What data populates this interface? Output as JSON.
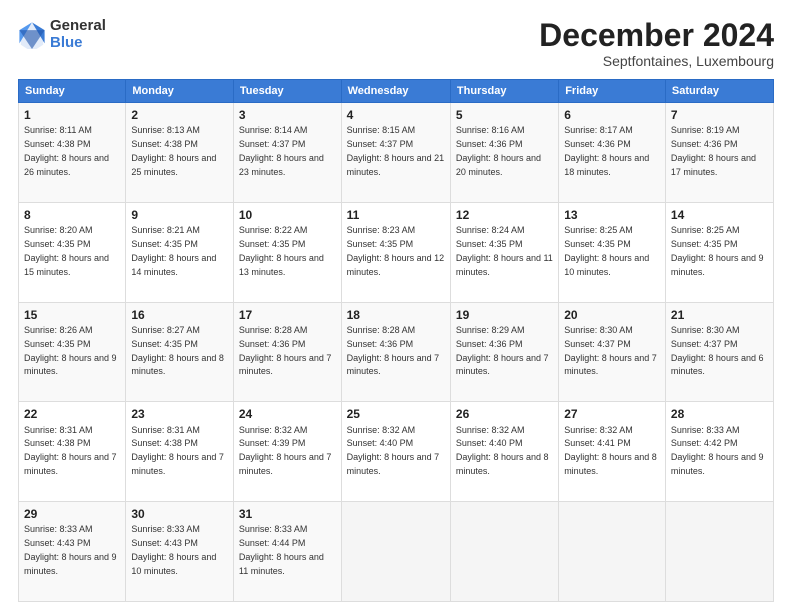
{
  "header": {
    "logo_general": "General",
    "logo_blue": "Blue",
    "title": "December 2024",
    "location": "Septfontaines, Luxembourg"
  },
  "days_of_week": [
    "Sunday",
    "Monday",
    "Tuesday",
    "Wednesday",
    "Thursday",
    "Friday",
    "Saturday"
  ],
  "weeks": [
    [
      {
        "day": "1",
        "sunrise": "8:11 AM",
        "sunset": "4:38 PM",
        "daylight": "8 hours and 26 minutes."
      },
      {
        "day": "2",
        "sunrise": "8:13 AM",
        "sunset": "4:38 PM",
        "daylight": "8 hours and 25 minutes."
      },
      {
        "day": "3",
        "sunrise": "8:14 AM",
        "sunset": "4:37 PM",
        "daylight": "8 hours and 23 minutes."
      },
      {
        "day": "4",
        "sunrise": "8:15 AM",
        "sunset": "4:37 PM",
        "daylight": "8 hours and 21 minutes."
      },
      {
        "day": "5",
        "sunrise": "8:16 AM",
        "sunset": "4:36 PM",
        "daylight": "8 hours and 20 minutes."
      },
      {
        "day": "6",
        "sunrise": "8:17 AM",
        "sunset": "4:36 PM",
        "daylight": "8 hours and 18 minutes."
      },
      {
        "day": "7",
        "sunrise": "8:19 AM",
        "sunset": "4:36 PM",
        "daylight": "8 hours and 17 minutes."
      }
    ],
    [
      {
        "day": "8",
        "sunrise": "8:20 AM",
        "sunset": "4:35 PM",
        "daylight": "8 hours and 15 minutes."
      },
      {
        "day": "9",
        "sunrise": "8:21 AM",
        "sunset": "4:35 PM",
        "daylight": "8 hours and 14 minutes."
      },
      {
        "day": "10",
        "sunrise": "8:22 AM",
        "sunset": "4:35 PM",
        "daylight": "8 hours and 13 minutes."
      },
      {
        "day": "11",
        "sunrise": "8:23 AM",
        "sunset": "4:35 PM",
        "daylight": "8 hours and 12 minutes."
      },
      {
        "day": "12",
        "sunrise": "8:24 AM",
        "sunset": "4:35 PM",
        "daylight": "8 hours and 11 minutes."
      },
      {
        "day": "13",
        "sunrise": "8:25 AM",
        "sunset": "4:35 PM",
        "daylight": "8 hours and 10 minutes."
      },
      {
        "day": "14",
        "sunrise": "8:25 AM",
        "sunset": "4:35 PM",
        "daylight": "8 hours and 9 minutes."
      }
    ],
    [
      {
        "day": "15",
        "sunrise": "8:26 AM",
        "sunset": "4:35 PM",
        "daylight": "8 hours and 9 minutes."
      },
      {
        "day": "16",
        "sunrise": "8:27 AM",
        "sunset": "4:35 PM",
        "daylight": "8 hours and 8 minutes."
      },
      {
        "day": "17",
        "sunrise": "8:28 AM",
        "sunset": "4:36 PM",
        "daylight": "8 hours and 7 minutes."
      },
      {
        "day": "18",
        "sunrise": "8:28 AM",
        "sunset": "4:36 PM",
        "daylight": "8 hours and 7 minutes."
      },
      {
        "day": "19",
        "sunrise": "8:29 AM",
        "sunset": "4:36 PM",
        "daylight": "8 hours and 7 minutes."
      },
      {
        "day": "20",
        "sunrise": "8:30 AM",
        "sunset": "4:37 PM",
        "daylight": "8 hours and 7 minutes."
      },
      {
        "day": "21",
        "sunrise": "8:30 AM",
        "sunset": "4:37 PM",
        "daylight": "8 hours and 6 minutes."
      }
    ],
    [
      {
        "day": "22",
        "sunrise": "8:31 AM",
        "sunset": "4:38 PM",
        "daylight": "8 hours and 7 minutes."
      },
      {
        "day": "23",
        "sunrise": "8:31 AM",
        "sunset": "4:38 PM",
        "daylight": "8 hours and 7 minutes."
      },
      {
        "day": "24",
        "sunrise": "8:32 AM",
        "sunset": "4:39 PM",
        "daylight": "8 hours and 7 minutes."
      },
      {
        "day": "25",
        "sunrise": "8:32 AM",
        "sunset": "4:40 PM",
        "daylight": "8 hours and 7 minutes."
      },
      {
        "day": "26",
        "sunrise": "8:32 AM",
        "sunset": "4:40 PM",
        "daylight": "8 hours and 8 minutes."
      },
      {
        "day": "27",
        "sunrise": "8:32 AM",
        "sunset": "4:41 PM",
        "daylight": "8 hours and 8 minutes."
      },
      {
        "day": "28",
        "sunrise": "8:33 AM",
        "sunset": "4:42 PM",
        "daylight": "8 hours and 9 minutes."
      }
    ],
    [
      {
        "day": "29",
        "sunrise": "8:33 AM",
        "sunset": "4:43 PM",
        "daylight": "8 hours and 9 minutes."
      },
      {
        "day": "30",
        "sunrise": "8:33 AM",
        "sunset": "4:43 PM",
        "daylight": "8 hours and 10 minutes."
      },
      {
        "day": "31",
        "sunrise": "8:33 AM",
        "sunset": "4:44 PM",
        "daylight": "8 hours and 11 minutes."
      },
      null,
      null,
      null,
      null
    ]
  ]
}
